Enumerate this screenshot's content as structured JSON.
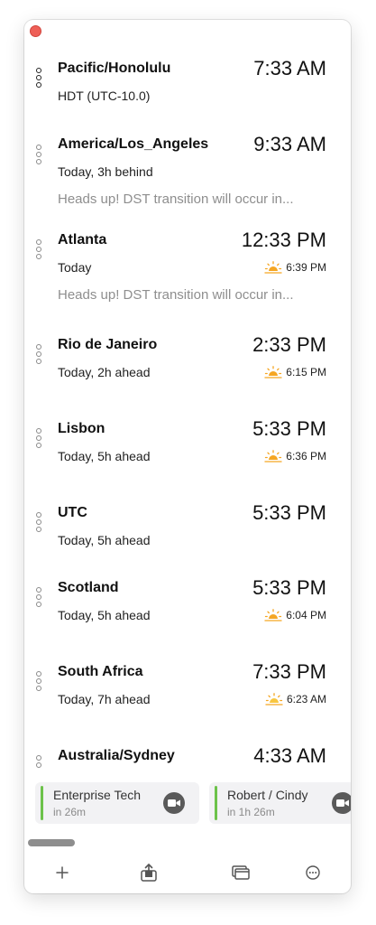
{
  "zones": [
    {
      "name": "Pacific/Honolulu",
      "time": "7:33 AM",
      "sub": "HDT (UTC-10.0)",
      "warning": "",
      "sunrise": ""
    },
    {
      "name": "America/Los_Angeles",
      "time": "9:33 AM",
      "sub": "Today, 3h behind",
      "warning": "Heads up! DST transition will occur in...",
      "sunrise": ""
    },
    {
      "name": "Atlanta",
      "time": "12:33 PM",
      "sub": "Today",
      "warning": "Heads up! DST transition will occur in...",
      "sunrise": "6:39 PM"
    },
    {
      "name": "Rio de Janeiro",
      "time": "2:33 PM",
      "sub": "Today, 2h ahead",
      "warning": "",
      "sunrise": "6:15 PM"
    },
    {
      "name": "Lisbon",
      "time": "5:33 PM",
      "sub": "Today, 5h ahead",
      "warning": "",
      "sunrise": "6:36 PM"
    },
    {
      "name": "UTC",
      "time": "5:33 PM",
      "sub": "Today, 5h ahead",
      "warning": "",
      "sunrise": ""
    },
    {
      "name": "Scotland",
      "time": "5:33 PM",
      "sub": "Today, 5h ahead",
      "warning": "",
      "sunrise": "6:04 PM"
    },
    {
      "name": "South Africa",
      "time": "7:33 PM",
      "sub": "Today, 7h ahead",
      "warning": "",
      "sunrise": "6:23 AM"
    },
    {
      "name": "Australia/Sydney",
      "time": "4:33 AM",
      "sub": "",
      "warning": "",
      "sunrise": ""
    }
  ],
  "meetings": [
    {
      "title": "Enterprise Tech",
      "when": "in 26m"
    },
    {
      "title": "Robert / Cindy",
      "when": "in 1h 26m"
    }
  ],
  "colors": {
    "sun_orange": "#f5a623",
    "meeting_bar": "#6cc24a",
    "close_button": "#ee5f57"
  },
  "icons": {
    "sun": "sun-horizon-icon",
    "camera": "video-camera-icon",
    "add": "plus-icon",
    "share": "share-icon",
    "windows": "windows-icon",
    "more": "more-icon"
  }
}
